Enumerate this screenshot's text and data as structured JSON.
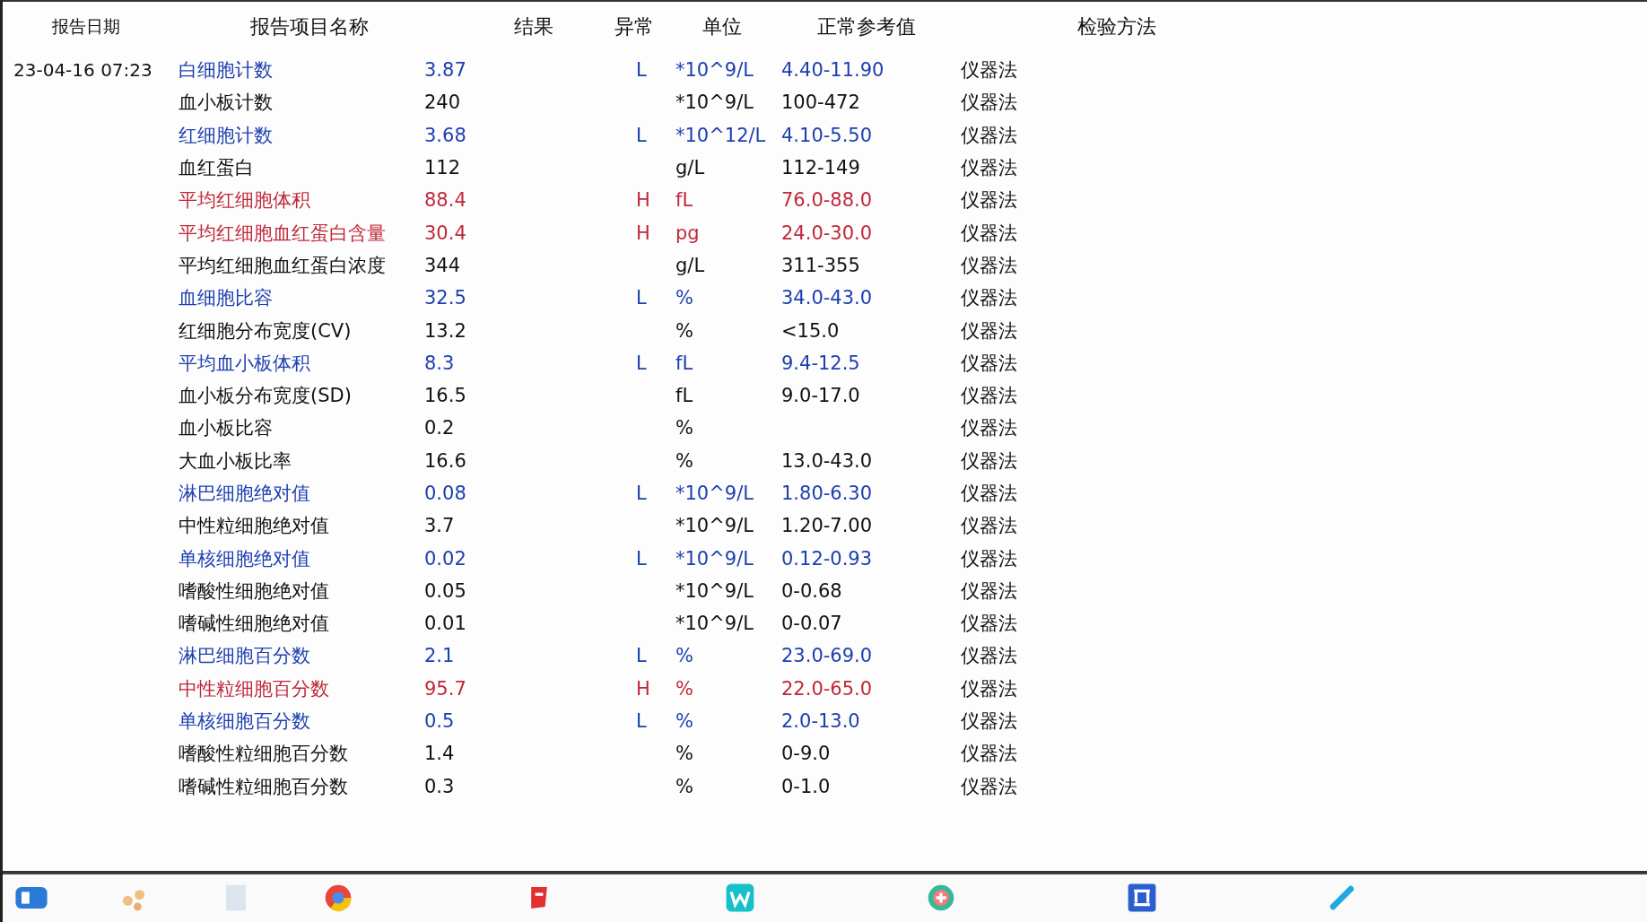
{
  "columns": [
    "报告日期",
    "报告项目名称",
    "结果",
    "异常",
    "单位",
    "正常参考值",
    "检验方法"
  ],
  "rows": [
    {
      "date": "23-04-16 07:23",
      "name": "白细胞计数",
      "result": "3.87",
      "flag": "L",
      "unit": "*10^9/L",
      "range": "4.40-11.90",
      "method": "仪器法"
    },
    {
      "name": "血小板计数",
      "result": "240",
      "flag": "",
      "unit": "*10^9/L",
      "range": "100-472",
      "method": "仪器法"
    },
    {
      "name": "红细胞计数",
      "result": "3.68",
      "flag": "L",
      "unit": "*10^12/L",
      "range": "4.10-5.50",
      "method": "仪器法"
    },
    {
      "name": "血红蛋白",
      "result": "112",
      "flag": "",
      "unit": "g/L",
      "range": "112-149",
      "method": "仪器法"
    },
    {
      "name": "平均红细胞体积",
      "result": "88.4",
      "flag": "H",
      "unit": "fL",
      "range": "76.0-88.0",
      "method": "仪器法"
    },
    {
      "name": "平均红细胞血红蛋白含量",
      "result": "30.4",
      "flag": "H",
      "unit": "pg",
      "range": "24.0-30.0",
      "method": "仪器法"
    },
    {
      "name": "平均红细胞血红蛋白浓度",
      "result": "344",
      "flag": "",
      "unit": "g/L",
      "range": "311-355",
      "method": "仪器法"
    },
    {
      "name": "血细胞比容",
      "result": "32.5",
      "flag": "L",
      "unit": "%",
      "range": "34.0-43.0",
      "method": "仪器法"
    },
    {
      "name": "红细胞分布宽度(CV)",
      "result": "13.2",
      "flag": "",
      "unit": "%",
      "range": "<15.0",
      "method": "仪器法"
    },
    {
      "name": "平均血小板体积",
      "result": "8.3",
      "flag": "L",
      "unit": "fL",
      "range": "9.4-12.5",
      "method": "仪器法"
    },
    {
      "name": "血小板分布宽度(SD)",
      "result": "16.5",
      "flag": "",
      "unit": "fL",
      "range": "9.0-17.0",
      "method": "仪器法"
    },
    {
      "name": "血小板比容",
      "result": "0.2",
      "flag": "",
      "unit": "%",
      "range": "",
      "method": "仪器法"
    },
    {
      "name": "大血小板比率",
      "result": "16.6",
      "flag": "",
      "unit": "%",
      "range": "13.0-43.0",
      "method": "仪器法"
    },
    {
      "name": "淋巴细胞绝对值",
      "result": "0.08",
      "flag": "L",
      "unit": "*10^9/L",
      "range": "1.80-6.30",
      "method": "仪器法"
    },
    {
      "name": "中性粒细胞绝对值",
      "result": "3.7",
      "flag": "",
      "unit": "*10^9/L",
      "range": "1.20-7.00",
      "method": "仪器法"
    },
    {
      "name": "单核细胞绝对值",
      "result": "0.02",
      "flag": "L",
      "unit": "*10^9/L",
      "range": "0.12-0.93",
      "method": "仪器法"
    },
    {
      "name": "嗜酸性细胞绝对值",
      "result": "0.05",
      "flag": "",
      "unit": "*10^9/L",
      "range": "0-0.68",
      "method": "仪器法"
    },
    {
      "name": "嗜碱性细胞绝对值",
      "result": "0.01",
      "flag": "",
      "unit": "*10^9/L",
      "range": "0-0.07",
      "method": "仪器法"
    },
    {
      "name": "淋巴细胞百分数",
      "result": "2.1",
      "flag": "L",
      "unit": "%",
      "range": "23.0-69.0",
      "method": "仪器法"
    },
    {
      "name": "中性粒细胞百分数",
      "result": "95.7",
      "flag": "H",
      "unit": "%",
      "range": "22.0-65.0",
      "method": "仪器法"
    },
    {
      "name": "单核细胞百分数",
      "result": "0.5",
      "flag": "L",
      "unit": "%",
      "range": "2.0-13.0",
      "method": "仪器法"
    },
    {
      "name": "嗜酸性粒细胞百分数",
      "result": "1.4",
      "flag": "",
      "unit": "%",
      "range": "0-9.0",
      "method": "仪器法"
    },
    {
      "name": "嗜碱性粒细胞百分数",
      "result": "0.3",
      "flag": "",
      "unit": "%",
      "range": "0-1.0",
      "method": "仪器法"
    }
  ],
  "taskbar": [
    {
      "kind": "start"
    },
    {
      "kind": "dots"
    },
    {
      "kind": "doc"
    },
    {
      "kind": "browser"
    },
    {
      "kind": "red"
    },
    {
      "kind": "w"
    },
    {
      "kind": "medical"
    },
    {
      "kind": "blue"
    },
    {
      "kind": "pen"
    }
  ]
}
